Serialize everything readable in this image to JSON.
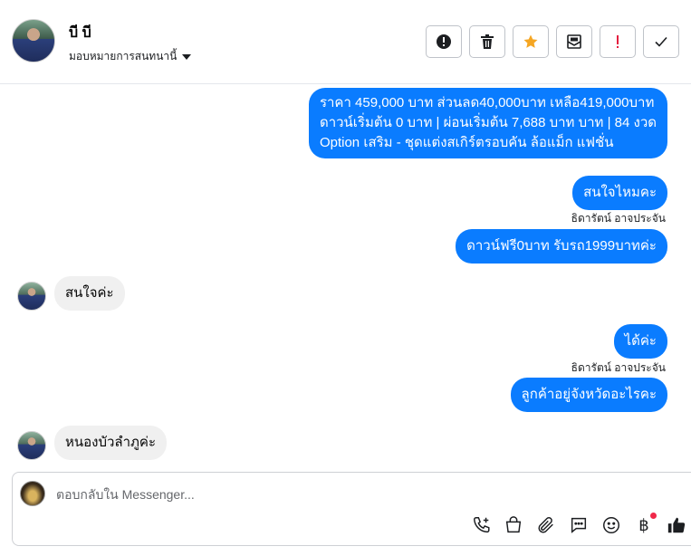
{
  "contact": {
    "name": "บี บี",
    "assign_label": "มอบหมายการสนทนานี้"
  },
  "toolbar": [
    {
      "name": "spam-button",
      "icon": "alert-circle-icon"
    },
    {
      "name": "delete-button",
      "icon": "trash-icon"
    },
    {
      "name": "star-button",
      "icon": "star-icon",
      "color": "#f5a623"
    },
    {
      "name": "unread-button",
      "icon": "mail-icon"
    },
    {
      "name": "priority-button",
      "icon": "exclamation-icon",
      "color": "#e41e3f"
    },
    {
      "name": "done-button",
      "icon": "check-icon"
    }
  ],
  "messages": {
    "m1_line1": "ราคา 459,000 บาท ส่วนลด40,000บาท เหลือ419,000บาท",
    "m1_line2": "ดาวน์เริ่มต้น 0 บาท | ผ่อนเริ่มต้น 7,688 บาท บาท | 84 งวด",
    "m1_line3": " Option เสริม - ชุดแต่งสเกิร์ตรอบคัน ล้อแม็ก แฟชั่น",
    "m2": "สนใจไหมคะ",
    "m2_sender": "ธิดารัตน์ อาจประจัน",
    "m3": "ดาวน์ฟรี0บาท รับรถ1999บาทค่ะ",
    "m4": "สนใจค่ะ",
    "m5": "ได้ค่ะ",
    "m5_sender": "ธิดารัตน์ อาจประจัน",
    "m6": "ลูกค้าอยู่จังหวัดอะไรคะ",
    "m7": "หนองบัวลำภูค่ะ"
  },
  "composer": {
    "placeholder": "ตอบกลับใน Messenger...",
    "icons": [
      "call-add-icon",
      "shopping-bag-icon",
      "paperclip-icon",
      "saved-reply-icon",
      "emoji-icon",
      "baht-icon",
      "thumbs-up-icon"
    ]
  },
  "colors": {
    "outgoing": "#0a7cff",
    "incoming": "#f0f0f0",
    "badge": "#f02849"
  }
}
